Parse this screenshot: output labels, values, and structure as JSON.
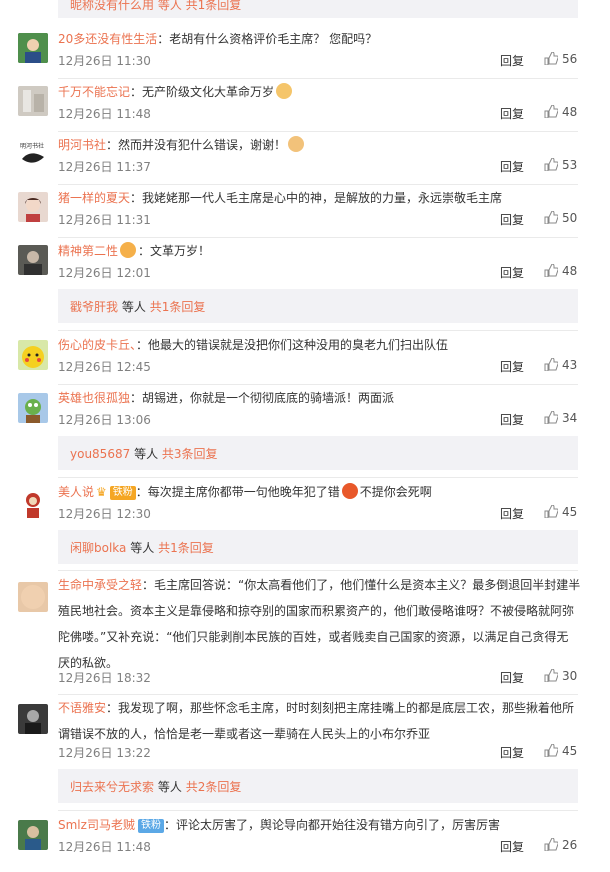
{
  "top_reply": {
    "text": "昵称没有什么用 等人 共1条回复"
  },
  "comments": [
    {
      "user": "20多还没有性生活",
      "text": "：老胡有什么资格评价毛主席？ 您配吗？",
      "time": "12月26日 11:30",
      "reply": "回复",
      "likes": "56"
    },
    {
      "user": "千万不能忘记",
      "text": "：无产阶级文化大革命万岁",
      "time": "12月26日 11:48",
      "reply": "回复",
      "likes": "48",
      "emoji": "fist-emoji"
    },
    {
      "user": "明河书社",
      "text": "：然而并没有犯什么错误，谢谢！",
      "time": "12月26日 11:37",
      "reply": "回复",
      "likes": "53",
      "emoji": "pray-emoji"
    },
    {
      "user": "猪一样的夏天",
      "text": "：我姥姥那一代人毛主席是心中的神，是解放的力量，永远崇敬毛主席",
      "time": "12月26日 11:31",
      "reply": "回复",
      "likes": "50"
    },
    {
      "user": "精神第二性",
      "text": "：文革万岁！",
      "time": "12月26日 12:01",
      "reply": "回复",
      "likes": "48",
      "sub": {
        "user": "戳爷肝我",
        "wait": "等人",
        "count": "共1条回复"
      }
    },
    {
      "user": "伤心的皮卡丘、",
      "text": "：他最大的错误就是没把你们这种没用的臭老九们扫出队伍",
      "time": "12月26日 12:45",
      "reply": "回复",
      "likes": "43"
    },
    {
      "user": "英雄也很孤独",
      "text": "：胡锡进，你就是一个彻彻底底的骑墙派！两面派",
      "time": "12月26日 13:06",
      "reply": "回复",
      "likes": "34",
      "sub": {
        "user": "you85687",
        "wait": "等人",
        "count": "共3条回复"
      }
    },
    {
      "user": "美人说",
      "badge": "铁粉",
      "text_before": "：每次提主席你都带一句他晚年犯了错",
      "text_after": "不提你会死啊",
      "time": "12月26日 12:30",
      "reply": "回复",
      "likes": "45",
      "sub": {
        "user": "闲聊bolka",
        "wait": "等人",
        "count": "共1条回复"
      }
    },
    {
      "user": "生命中承受之轻",
      "text_lines": [
        "：毛主席回答说：“你太高看他们了，他们懂什么是资本主义？最多倒退回半封建半",
        "殖民地社会。资本主义是靠侵略和掠夺别的国家而积累资产的，他们敢侵略谁呀？不被侵略就阿弥",
        "陀佛喽。”又补充说：“他们只能剥削本民族的百姓，或者贱卖自己国家的资源，以满足自己贪得无",
        "厌的私欲。"
      ],
      "time": "12月26日 18:32",
      "reply": "回复",
      "likes": "30"
    },
    {
      "user": "不语雅安",
      "text_lines": [
        "：我发现了啊，那些怀念毛主席，时时刻刻把主席挂嘴上的都是底层工农，那些揪着他所",
        "谓错误不放的人，恰恰是老一辈或者这一辈骑在人民头上的小布尔乔亚"
      ],
      "time": "12月26日 13:22",
      "reply": "回复",
      "likes": "45",
      "sub": {
        "user": "归去来兮无求索",
        "wait": "等人",
        "count": "共2条回复"
      }
    },
    {
      "user": "Smlz司马老贼",
      "badge": "铁粉",
      "text": "：评论太厉害了，舆论导向都开始往没有错方向引了，厉害厉害",
      "time": "12月26日 11:48",
      "reply": "回复",
      "likes": "26"
    }
  ]
}
